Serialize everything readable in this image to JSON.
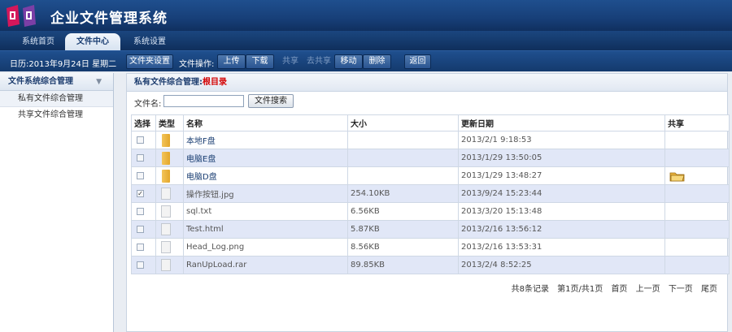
{
  "app": {
    "title": "企业文件管理系统"
  },
  "nav": {
    "tabs": [
      {
        "label": "系统首页"
      },
      {
        "label": "文件中心"
      },
      {
        "label": "系统设置"
      }
    ]
  },
  "toolbar": {
    "date": "日历:2013年9月24日 星期二",
    "folder_settings": "文件夹设置",
    "ops_label": "文件操作:",
    "upload": "上传",
    "download": "下载",
    "share": "共享",
    "unshare": "去共享",
    "move": "移动",
    "delete": "删除",
    "back": "返回"
  },
  "sidebar": {
    "title": "文件系统综合管理",
    "items": [
      {
        "label": "私有文件综合管理"
      },
      {
        "label": "共享文件综合管理"
      }
    ]
  },
  "main": {
    "breadcrumb_prefix": "私有文件综合管理:",
    "breadcrumb_root": "根目录",
    "search_label": "文件名:",
    "search_value": "",
    "search_button": "文件搜索",
    "columns": [
      "选择",
      "类型",
      "名称",
      "大小",
      "更新日期",
      "共享"
    ],
    "rows": [
      {
        "checked": false,
        "type": "folder",
        "name": "本地F盘",
        "size": "",
        "date": "2013/2/1 9:18:53",
        "shared": false
      },
      {
        "checked": false,
        "type": "folder",
        "name": "电脑E盘",
        "size": "",
        "date": "2013/1/29 13:50:05",
        "shared": false
      },
      {
        "checked": false,
        "type": "folder",
        "name": "电脑D盘",
        "size": "",
        "date": "2013/1/29 13:48:27",
        "shared": true
      },
      {
        "checked": true,
        "type": "file",
        "name": "操作按钮.jpg",
        "size": "254.10KB",
        "date": "2013/9/24 15:23:44",
        "shared": false
      },
      {
        "checked": false,
        "type": "file",
        "name": "sql.txt",
        "size": "6.56KB",
        "date": "2013/3/20 15:13:48",
        "shared": false
      },
      {
        "checked": false,
        "type": "file",
        "name": "Test.html",
        "size": "5.87KB",
        "date": "2013/2/16 13:56:12",
        "shared": false
      },
      {
        "checked": false,
        "type": "file",
        "name": "Head_Log.png",
        "size": "8.56KB",
        "date": "2013/2/16 13:53:31",
        "shared": false
      },
      {
        "checked": false,
        "type": "file",
        "name": "RanUpLoad.rar",
        "size": "89.85KB",
        "date": "2013/2/4 8:52:25",
        "shared": false
      }
    ],
    "pager": {
      "total": "共8条记录",
      "page": "第1页/共1页",
      "first": "首页",
      "prev": "上一页",
      "next": "下一页",
      "last": "尾页"
    }
  },
  "colors": {
    "header": "#1f4f8e",
    "accent_red": "#d40000",
    "row_alt": "#e1e7f7"
  }
}
